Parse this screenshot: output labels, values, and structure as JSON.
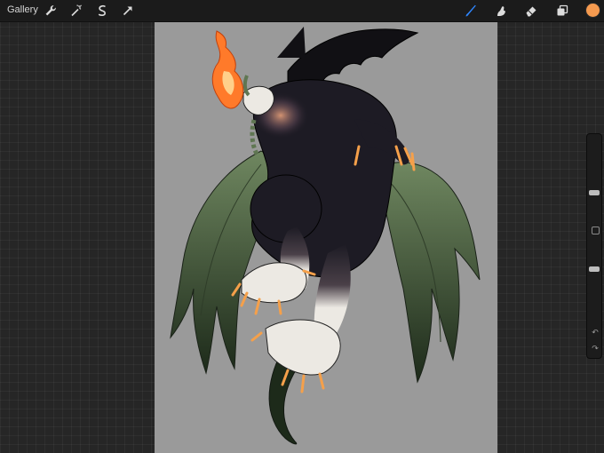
{
  "topbar": {
    "gallery_label": "Gallery",
    "left_tools": [
      "wrench-icon",
      "magic-wand-icon",
      "selection-icon",
      "transform-arrow-icon"
    ],
    "right_tools": [
      "brush-icon",
      "smudge-icon",
      "eraser-icon",
      "layers-icon"
    ],
    "active_tool": "brush-icon",
    "active_color": "#f59a4f",
    "accent_color": "#2e86ff"
  },
  "sidebar": {
    "brush_size_level": 0.3,
    "opacity_level": 0.65,
    "undo_icon": "undo-icon",
    "redo_icon": "redo-icon"
  },
  "canvas": {
    "background": "#9a9a9a",
    "palette": {
      "fur": "#1d1b24",
      "wing_leaf": "#5f7652",
      "wing_dark": "#1f2a1c",
      "claws_skin": "#ece9e3",
      "talons": "#f5a04a",
      "fire": "#ff7a2a"
    }
  }
}
